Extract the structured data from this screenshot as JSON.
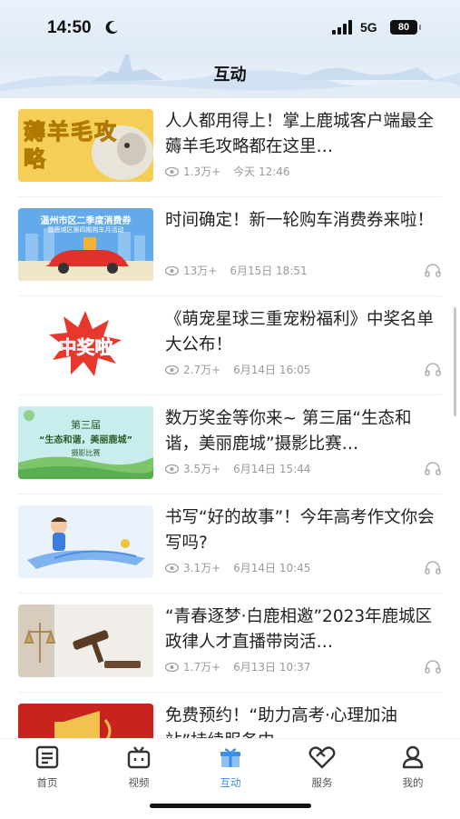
{
  "status_bar": {
    "time": "14:50",
    "network": "5G",
    "battery": "80"
  },
  "header": {
    "title": "互动"
  },
  "articles": [
    {
      "title": "人人都用得上！掌上鹿城客户端最全薅羊毛攻略都在这里…",
      "views": "1.3万+",
      "date": "今天 12:46",
      "thumb_text": "薅羊毛攻略",
      "audio": false
    },
    {
      "title": "时间确定！新一轮购车消费券来啦！",
      "views": "13万+",
      "date": "6月15日 18:51",
      "thumb_text": "温州市区二季度消费券",
      "thumb_subtext": "暨鹿城区第四期购车月活动",
      "audio": true
    },
    {
      "title": "《萌宠星球三重宠粉福利》中奖名单大公布！",
      "views": "2.7万+",
      "date": "6月14日 16:05",
      "thumb_text": "中奖啦",
      "audio": true
    },
    {
      "title": "数万奖金等你来~ 第三届“生态和谐，美丽鹿城”摄影比赛…",
      "views": "3.5万+",
      "date": "6月14日 15:44",
      "thumb_text": "第三届",
      "thumb_subtext": "“生态和谐，美丽鹿城”",
      "thumb_caption": "摄影比赛",
      "audio": true
    },
    {
      "title": "书写“好的故事”！今年高考作文你会写吗?",
      "views": "3.1万+",
      "date": "6月14日 10:45",
      "audio": true
    },
    {
      "title": "“青春逐梦·白鹿相邀”2023年鹿城区政律人才直播带岗活…",
      "views": "1.7万+",
      "date": "6月13日 10:37",
      "audio": true
    },
    {
      "title": "免费预约！“助力高考·心理加油站”持续服务中",
      "views": "",
      "date": "",
      "audio": false
    }
  ],
  "tabs": [
    {
      "label": "首页",
      "icon": "news-icon"
    },
    {
      "label": "视频",
      "icon": "tv-icon"
    },
    {
      "label": "互动",
      "icon": "gift-icon"
    },
    {
      "label": "服务",
      "icon": "service-icon"
    },
    {
      "label": "我的",
      "icon": "user-icon"
    }
  ],
  "colors": {
    "accent": "#3a8ee6",
    "meta_text": "#9a9a9a",
    "tab_text": "#555555"
  }
}
